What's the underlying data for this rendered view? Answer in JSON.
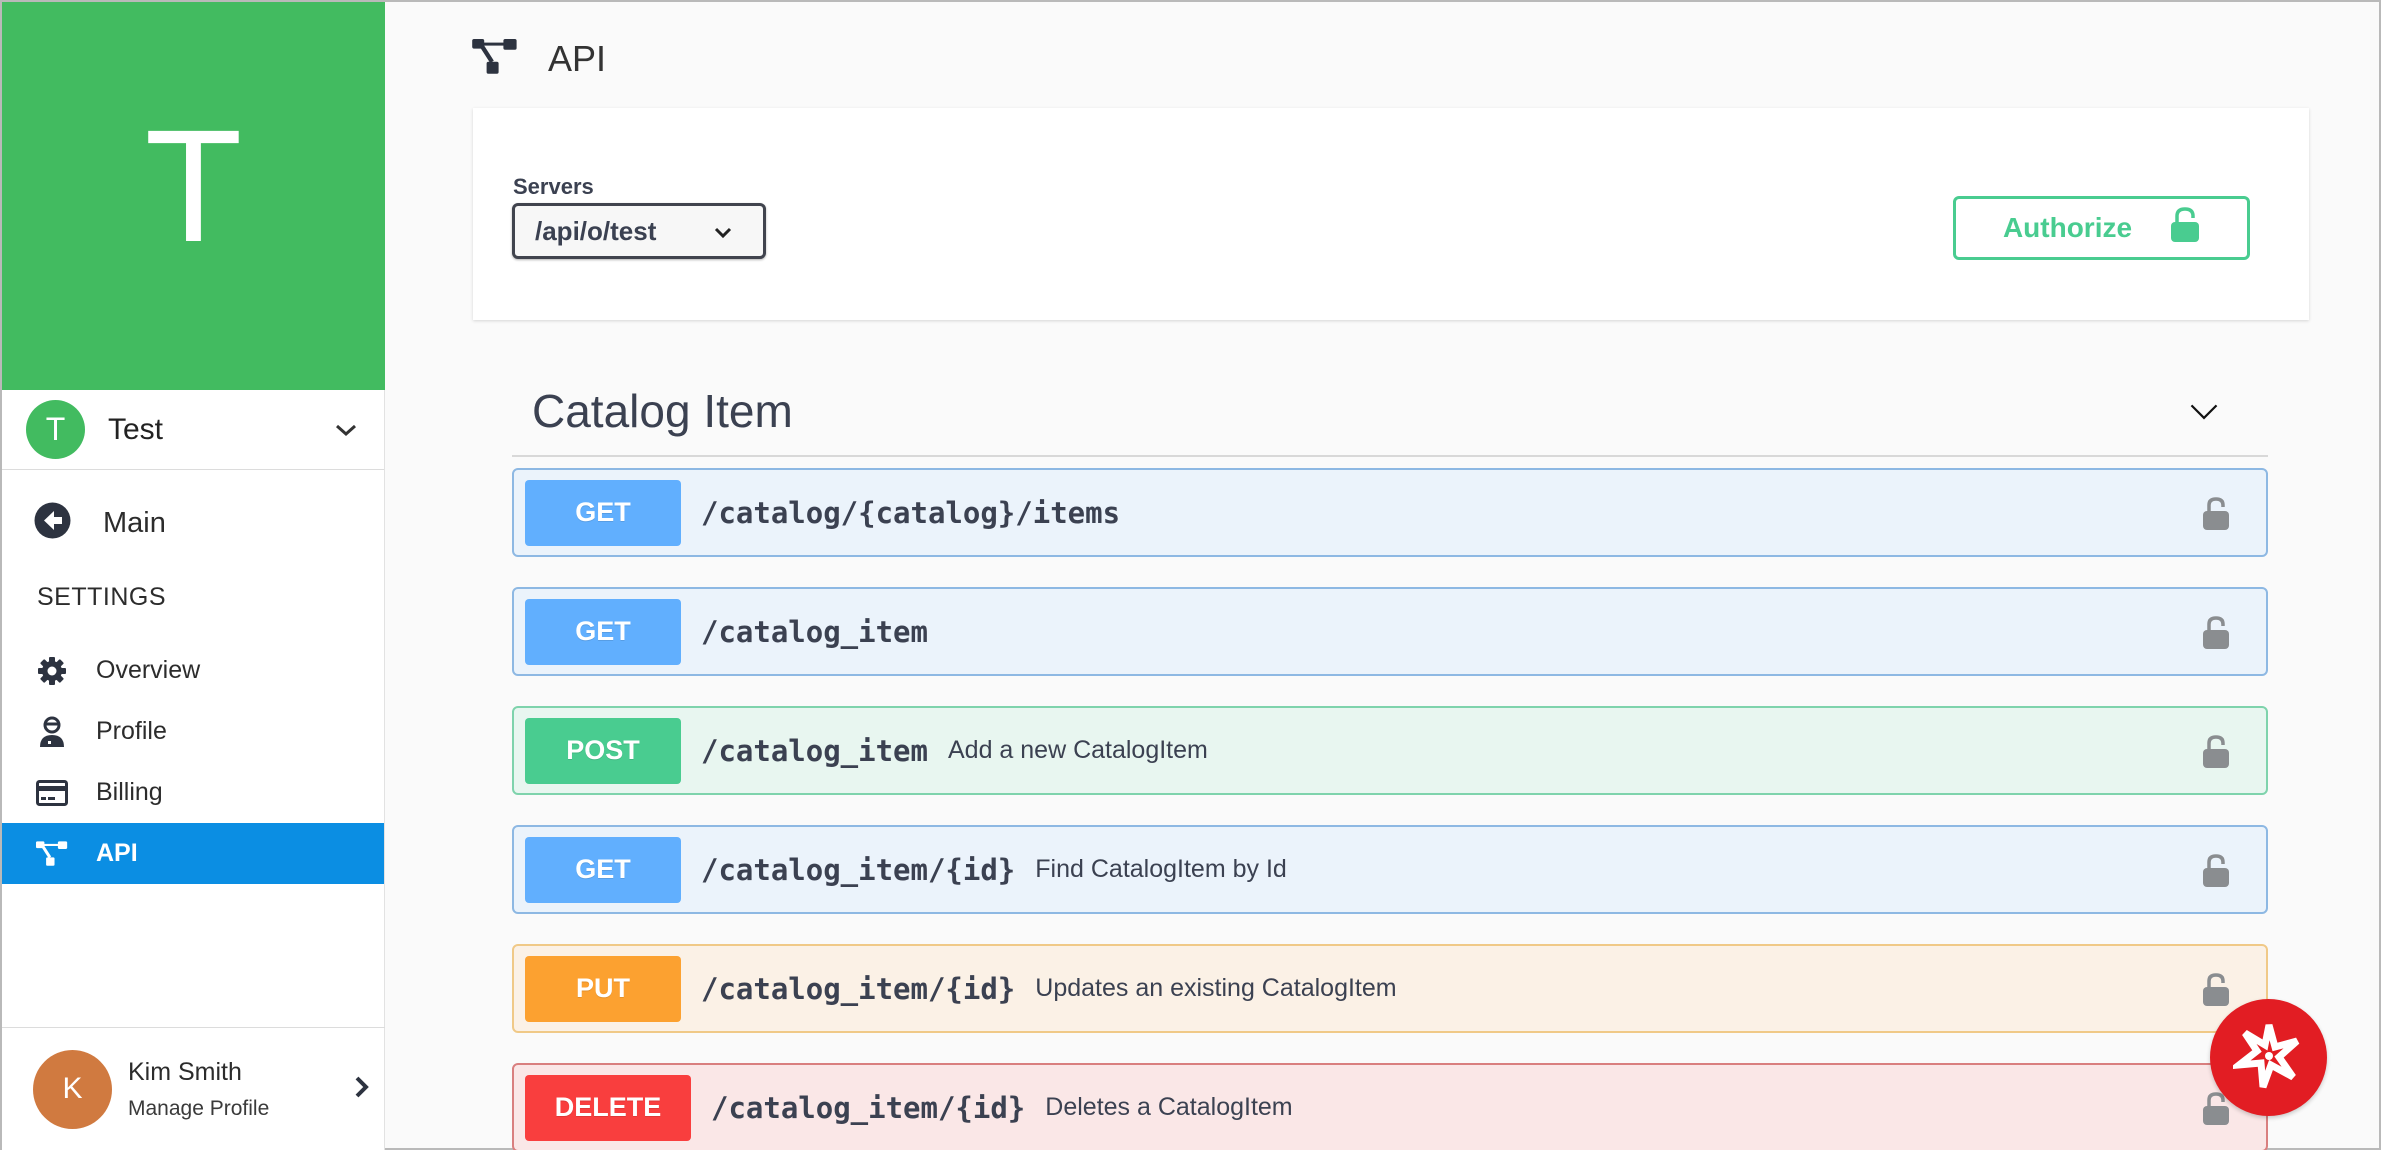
{
  "sidebar": {
    "org_initial": "T",
    "org_avatar_initial": "T",
    "org_name": "Test",
    "main_label": "Main",
    "settings_heading": "SETTINGS",
    "items": [
      {
        "label": "Overview",
        "icon": "gear-icon",
        "active": false
      },
      {
        "label": "Profile",
        "icon": "user-icon",
        "active": false
      },
      {
        "label": "Billing",
        "icon": "credit-card-icon",
        "active": false
      },
      {
        "label": "API",
        "icon": "sitemap-icon",
        "active": true
      }
    ],
    "profile": {
      "initial": "K",
      "name": "Kim Smith",
      "sub": "Manage Profile"
    }
  },
  "header": {
    "title": "API",
    "icon": "sitemap-icon"
  },
  "servers": {
    "label": "Servers",
    "selected": "/api/o/test"
  },
  "authorize": {
    "label": "Authorize"
  },
  "tag": {
    "title": "Catalog Item"
  },
  "operations": [
    {
      "method": "GET",
      "path": "/catalog/{catalog}/items",
      "summary": ""
    },
    {
      "method": "GET",
      "path": "/catalog_item",
      "summary": ""
    },
    {
      "method": "POST",
      "path": "/catalog_item",
      "summary": "Add a new CatalogItem"
    },
    {
      "method": "GET",
      "path": "/catalog_item/{id}",
      "summary": "Find CatalogItem by Id"
    },
    {
      "method": "PUT",
      "path": "/catalog_item/{id}",
      "summary": "Updates an existing CatalogItem"
    },
    {
      "method": "DELETE",
      "path": "/catalog_item/{id}",
      "summary": "Deletes a CatalogItem"
    }
  ],
  "colors": {
    "brand_green": "#42bb60",
    "active_nav": "#0b8ee3",
    "get": "#61affe",
    "post": "#49cc90",
    "put": "#fca130",
    "delete": "#f93e3e",
    "fab": "#e21d23"
  }
}
